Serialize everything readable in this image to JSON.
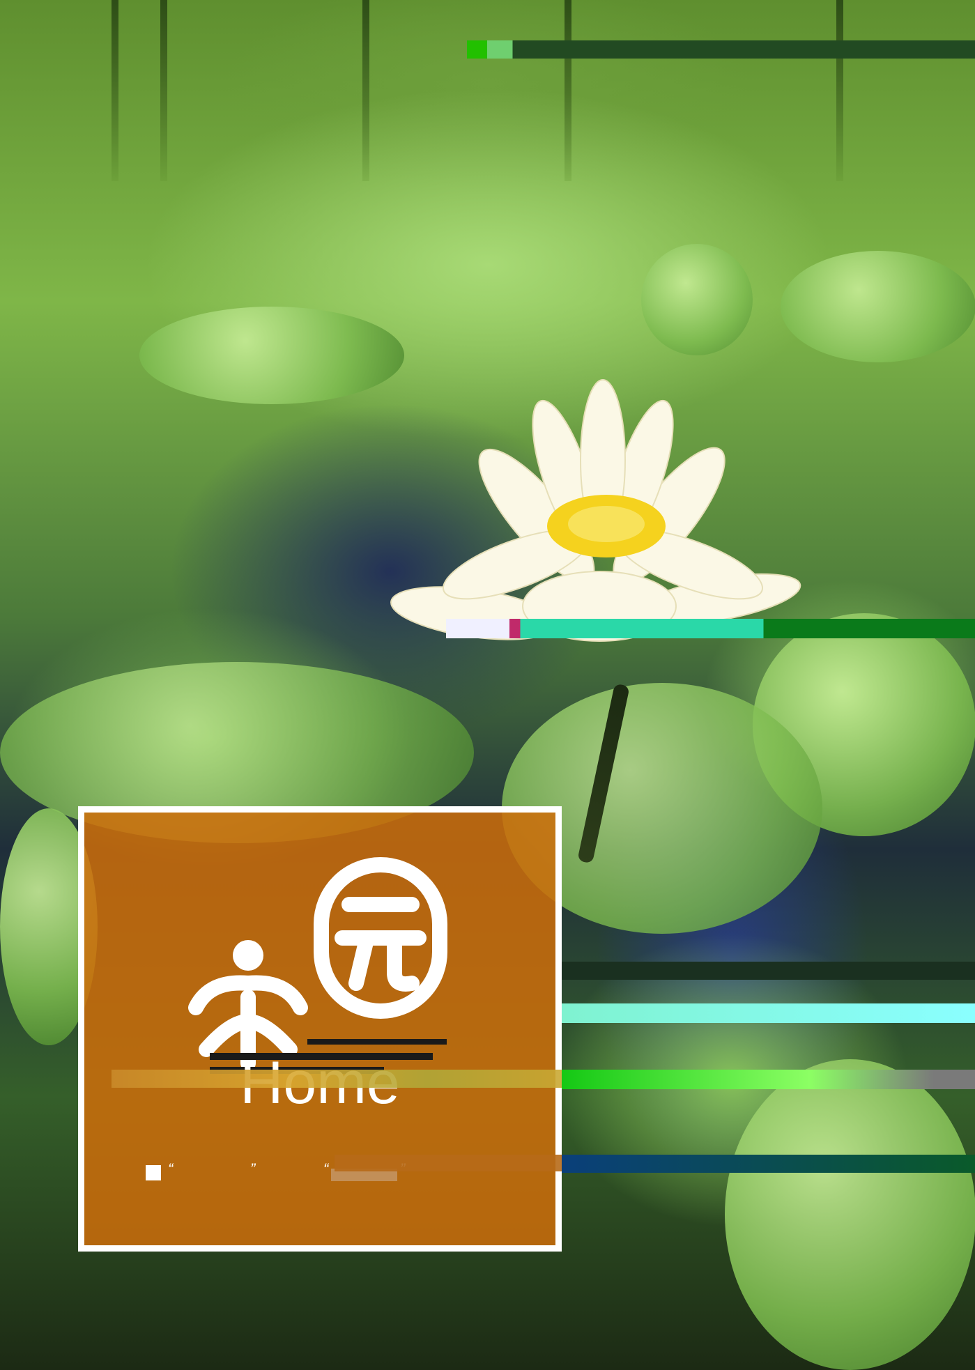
{
  "card": {
    "title": "Home",
    "quote_open_1": "“",
    "quote_close_1": "”",
    "quote_open_2": "“",
    "quote_close_2": "”"
  },
  "colors": {
    "card_fill": "#cd6e0a",
    "card_border": "#ffffff",
    "logo": "#ffffff"
  },
  "logo": {
    "icon": "circle-yuan-logo-icon"
  }
}
